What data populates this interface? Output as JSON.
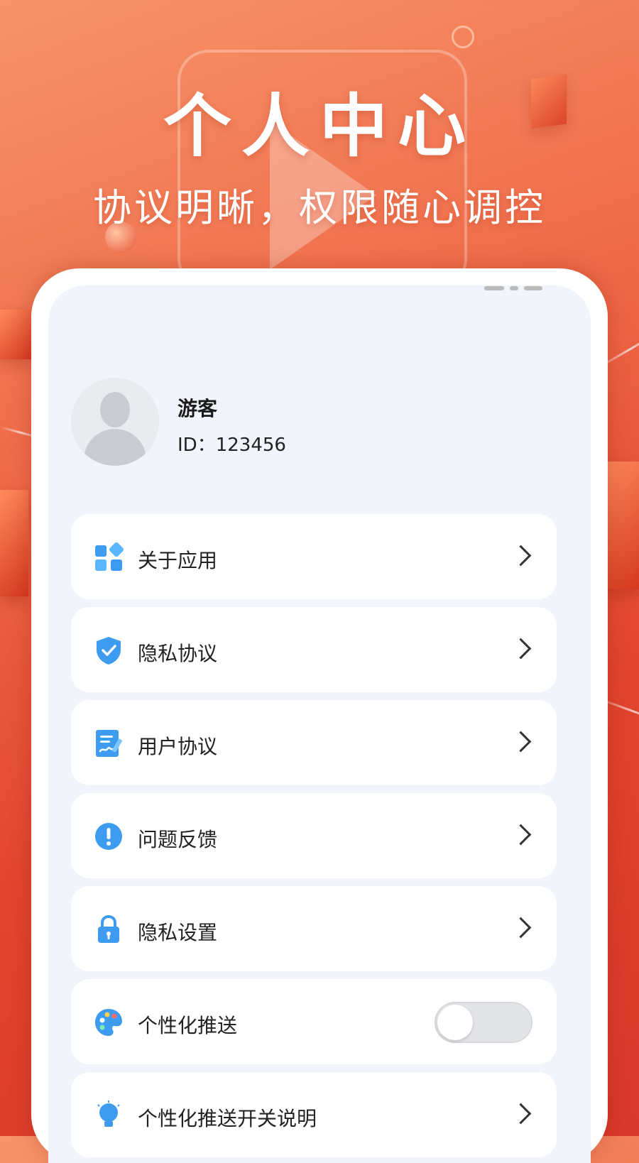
{
  "promo": {
    "title": "个人中心",
    "subtitle": "协议明晰，权限随心调控"
  },
  "profile": {
    "name": "游客",
    "id_text": "ID：123456"
  },
  "menu": [
    {
      "label": "关于应用",
      "icon": "apps-grid-icon",
      "control": "chevron"
    },
    {
      "label": "隐私协议",
      "icon": "shield-check-icon",
      "control": "chevron"
    },
    {
      "label": "用户协议",
      "icon": "document-sign-icon",
      "control": "chevron"
    },
    {
      "label": "问题反馈",
      "icon": "exclamation-circle-icon",
      "control": "chevron"
    },
    {
      "label": "隐私设置",
      "icon": "lock-icon",
      "control": "chevron"
    },
    {
      "label": "个性化推送",
      "icon": "palette-icon",
      "control": "toggle",
      "toggle_on": false
    },
    {
      "label": "个性化推送开关说明",
      "icon": "lightbulb-icon",
      "control": "chevron"
    }
  ],
  "colors": {
    "accent_blue": "#3d9bf0",
    "background_orange": "#ef6a48",
    "card_bg": "#ffffff",
    "screen_bg": "#f2f4fb"
  }
}
